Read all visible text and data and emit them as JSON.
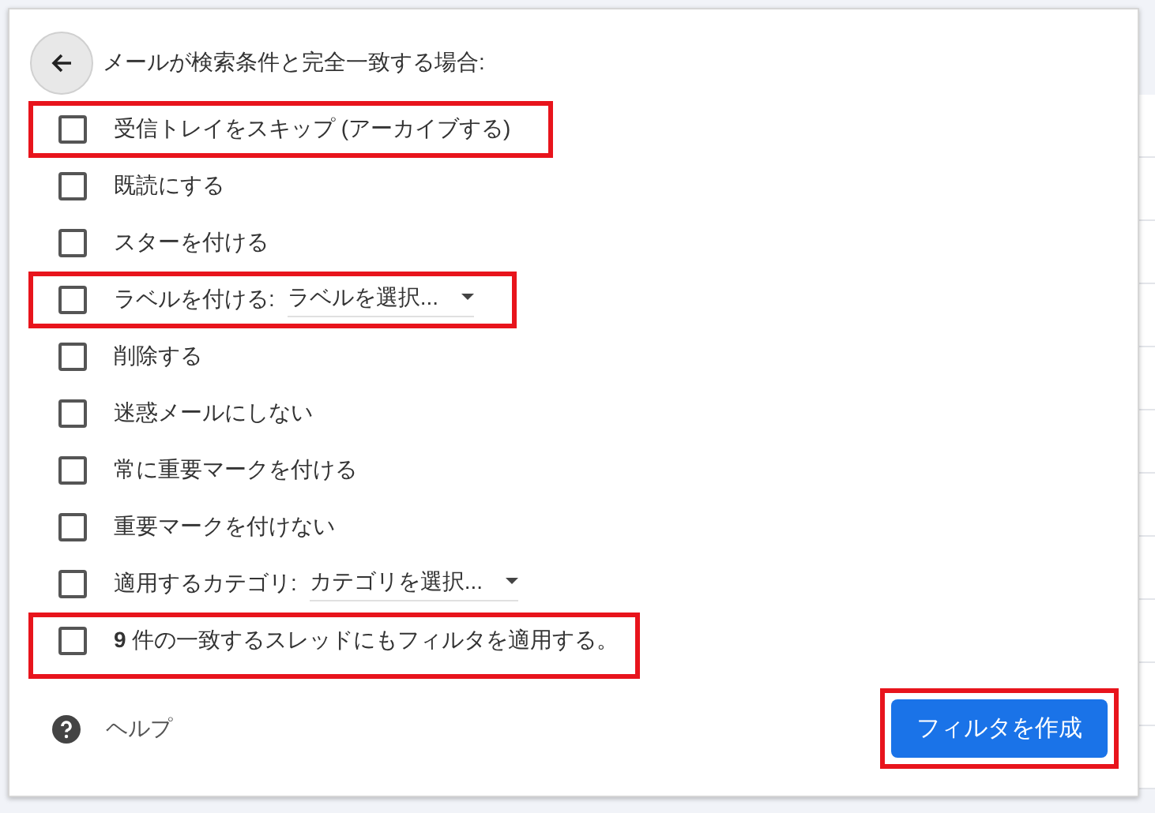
{
  "dialog": {
    "title": "メールが検索条件と完全一致する場合:",
    "actions": [
      {
        "kind": "checkbox",
        "label": "受信トレイをスキップ (アーカイブする)",
        "checked": false,
        "highlighted": true
      },
      {
        "kind": "checkbox",
        "label": "既読にする",
        "checked": false,
        "highlighted": false
      },
      {
        "kind": "checkbox",
        "label": "スターを付ける",
        "checked": false,
        "highlighted": false
      },
      {
        "kind": "select",
        "label": "ラベルを付ける:",
        "select": "ラベルを選択...",
        "checked": false,
        "highlighted": true
      },
      {
        "kind": "checkbox",
        "label": "削除する",
        "checked": false,
        "highlighted": false
      },
      {
        "kind": "checkbox",
        "label": "迷惑メールにしない",
        "checked": false,
        "highlighted": false
      },
      {
        "kind": "checkbox",
        "label": "常に重要マークを付ける",
        "checked": false,
        "highlighted": false
      },
      {
        "kind": "checkbox",
        "label": "重要マークを付けない",
        "checked": false,
        "highlighted": false
      },
      {
        "kind": "select",
        "label": "適用するカテゴリ:",
        "select": "カテゴリを選択...",
        "checked": false,
        "highlighted": false
      },
      {
        "kind": "checkbox",
        "label": "**9** 件の一致するスレッドにもフィルタを適用する。",
        "checked": false,
        "highlighted": true
      }
    ],
    "help": "ヘルプ",
    "create_button": {
      "label": "フィルタを作成",
      "highlighted": true
    }
  }
}
